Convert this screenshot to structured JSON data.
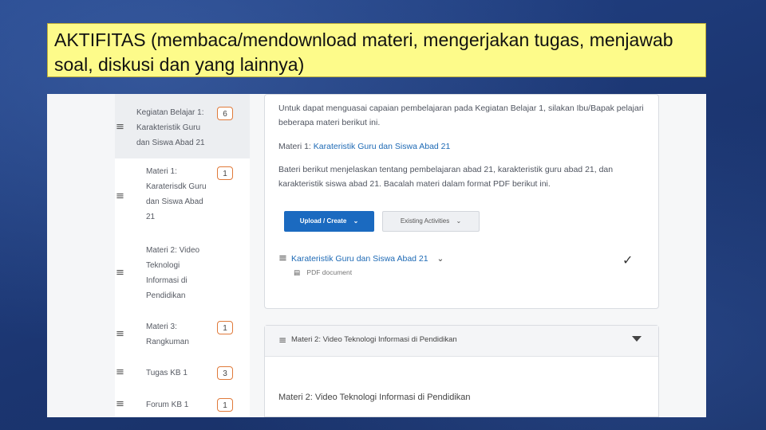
{
  "slide": {
    "title": "AKTIFITAS (membaca/mendownload materi, mengerjakan tugas, menjawab soal, diskusi dan yang lainnya)"
  },
  "sidebar": {
    "items": [
      {
        "label": "Kegiatan Belajar 1:\nKarakteristik Guru\ndan Siswa Abad 21",
        "count": "6"
      },
      {
        "label": "Materi 1:\nKaraterisdk Guru\ndan Siswa Abad\n21",
        "count": "1"
      },
      {
        "label": "Materi 2: Video\nTeknologi\nInformasi di\nPendidikan",
        "count": ""
      },
      {
        "label": "Materi 3:\nRangkuman",
        "count": "1"
      },
      {
        "label": "Tugas KB 1",
        "count": "3"
      },
      {
        "label": "Forum KB 1",
        "count": "1"
      }
    ]
  },
  "content": {
    "intro": "Untuk dapat menguasai capaian pembelajaran pada Kegiatan Belajar 1, silakan Ibu/Bapak pelajari beberapa materi berikut ini.",
    "materi_prefix": "Materi 1: ",
    "materi_link": "Karateristik Guru dan Siswa Abad 21",
    "description": "Bateri berikut menjelaskan tentang pembelajaran abad 21, karakteristik guru abad 21, dan karakteristik siswa abad 21. Bacalah materi dalam format PDF berikut ini.",
    "upload_button": "Upload / Create",
    "existing_button": "Existing Activities",
    "file_name": "Karateristik Guru dan Siswa Abad 21",
    "file_type": "PDF document",
    "section2_title": "Materi 2: Video Teknologi Informasi di Pendidikan",
    "section2_body": "Materi 2: Video Teknologi Informasi di Pendidikan"
  },
  "icons": {
    "drag": "drag-handle-icon",
    "check": "checkmark-icon",
    "chevron": "chevron-down-icon",
    "pdf": "document-icon"
  },
  "colors": {
    "title_bg": "#fdfb8a",
    "badge_border": "#e07a3a",
    "primary_button": "#1b6ac0",
    "link": "#1e6ab5"
  }
}
